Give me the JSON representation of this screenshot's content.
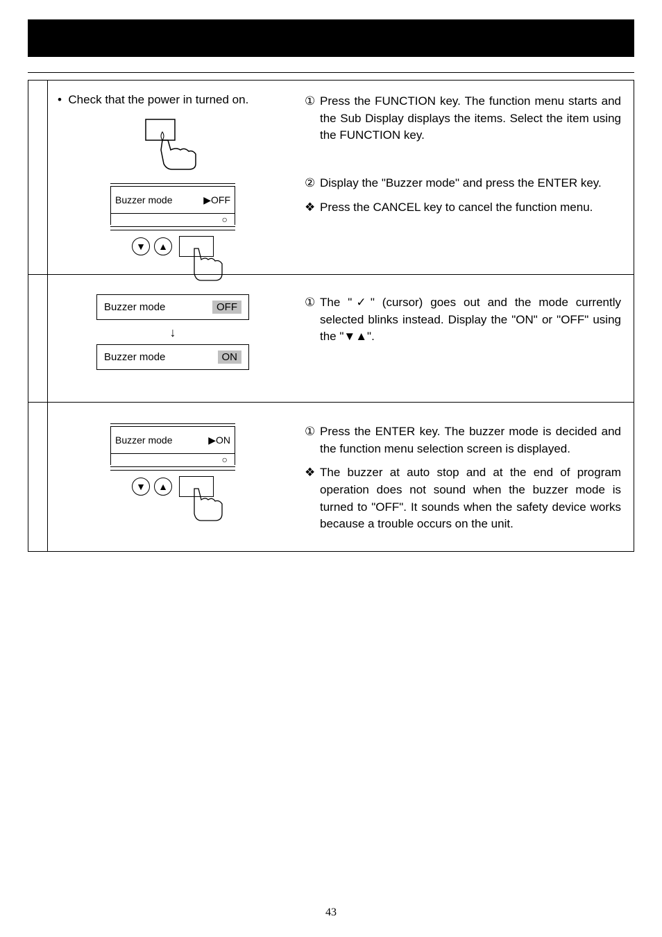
{
  "page_number": "43",
  "row1": {
    "check_text": "Check that the power in turned on.",
    "sub_display_label": "Buzzer mode",
    "sub_display_value": "▶OFF",
    "circle_lamp": "○",
    "step1_num": "①",
    "step1_text": "Press the FUNCTION key.  The function menu starts and the Sub Display displays the items. Select the item using the FUNCTION key.",
    "step2_num": "②",
    "step2_text": "Display the \"Buzzer mode\" and press the ENTER key.",
    "note_mark": "❖",
    "note_text": "Press the CANCEL key to cancel the function menu."
  },
  "row2": {
    "box1_label": "Buzzer mode",
    "box1_value": "OFF",
    "arrow": "↓",
    "box2_label": "Buzzer mode",
    "box2_value": "ON",
    "step1_num": "①",
    "step1_text": "The \"✓\" (cursor) goes out and the mode currently selected blinks instead.  Display the \"ON\" or \"OFF\" using the \"▼▲\"."
  },
  "row3": {
    "sub_display_label": "Buzzer mode",
    "sub_display_value": "▶ON",
    "circle_lamp": "○",
    "step1_num": "①",
    "step1_text": "Press the ENTER key.  The buzzer mode is decided and the function menu selection screen is displayed.",
    "note_mark": "❖",
    "note_text": "The buzzer at auto stop and at the end of program operation does not sound when the buzzer mode is turned to \"OFF\".  It sounds when the safety device works because a trouble occurs on the unit."
  },
  "icons": {
    "down_triangle": "▼",
    "up_triangle": "▲",
    "bullet": "•"
  }
}
